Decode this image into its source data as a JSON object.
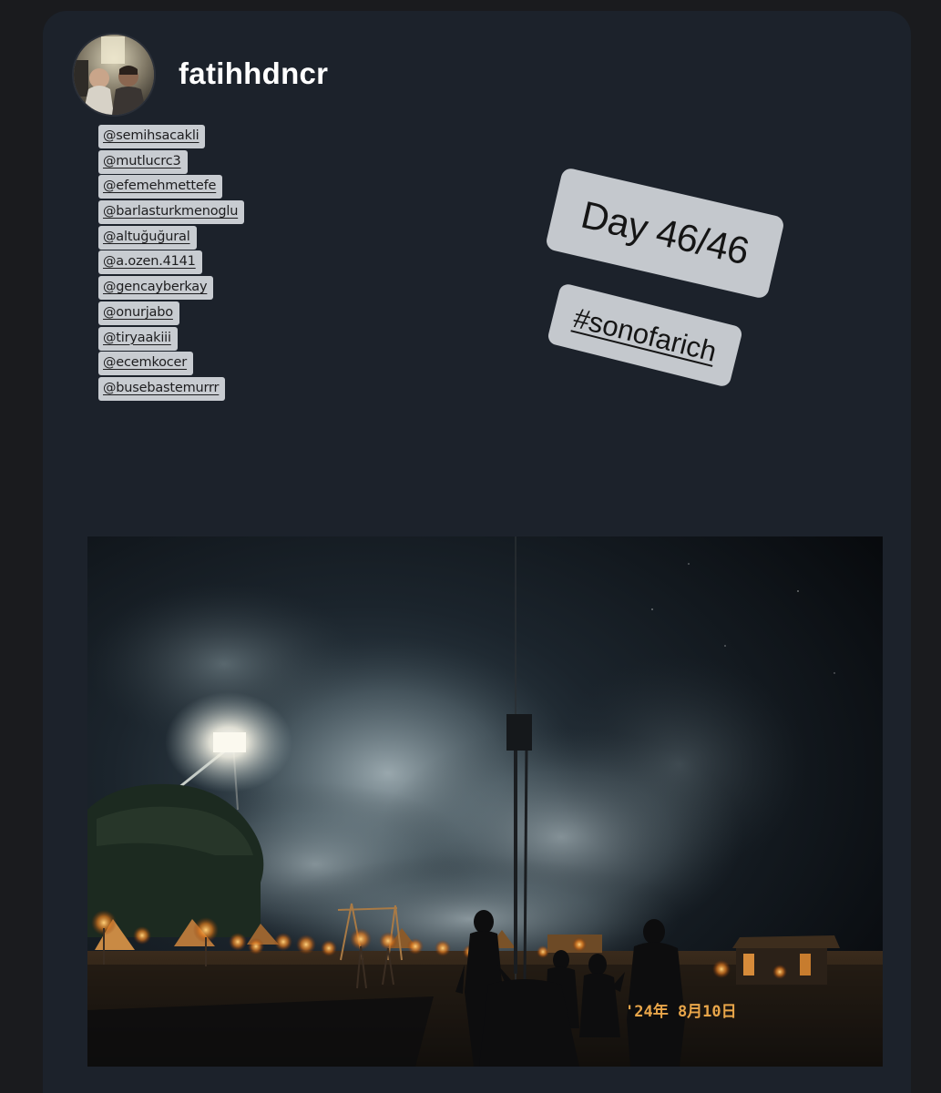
{
  "story": {
    "username": "fatihhdncr",
    "mentions": [
      "@semihsacakli",
      "@mutlucrc3",
      "@efemehmettefe",
      "@barlasturkmenoglu",
      "@altuğuğural",
      "@a.ozen.4141",
      "@gencayberkay",
      "@onurjabo",
      "@tiryaakiii",
      "@ecemkocer",
      "@busebastemurrr"
    ],
    "day_sticker": "Day 46/46",
    "hashtag_sticker": "#sonofarich",
    "photo_date_stamp": "'24年 8月10日"
  },
  "colors": {
    "background": "#1a1b1e",
    "card": "#1c222b",
    "sticker": "#c4c8cd",
    "date_stamp": "#e9a64a"
  }
}
